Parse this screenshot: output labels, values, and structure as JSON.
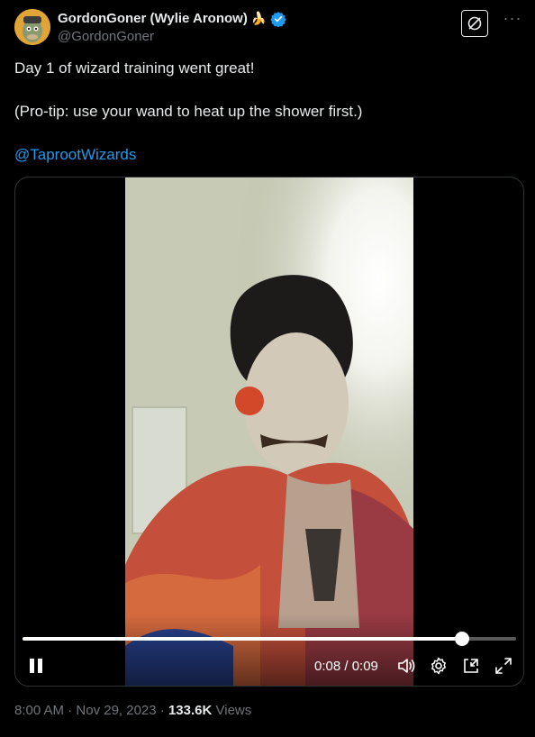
{
  "author": {
    "display_name": "GordonGoner (Wylie Aronow)",
    "handle": "@GordonGoner",
    "name_emoji": "🍌",
    "verified": true,
    "verified_color": "#1d9bf0"
  },
  "tweet": {
    "line1": "Day 1 of wizard training went great!",
    "line2": "(Pro-tip: use your wand to heat up the shower first.)",
    "mention": "@TaprootWizards",
    "mention_color": "#1d9bf0"
  },
  "video": {
    "current_time": "0:08",
    "duration": "0:09",
    "time_display": "0:08 / 0:09",
    "progress_fraction": 0.89,
    "state": "playing"
  },
  "meta": {
    "time": "8:00 AM",
    "date": "Nov 29, 2023",
    "views_count": "133.6K",
    "views_label": "Views"
  },
  "icons": {
    "grok": "grok-icon",
    "more": "more-icon",
    "verified": "verified-badge-icon",
    "pause": "pause-icon",
    "volume": "volume-icon",
    "settings": "settings-icon",
    "pip": "picture-in-picture-icon",
    "fullscreen": "fullscreen-icon"
  }
}
